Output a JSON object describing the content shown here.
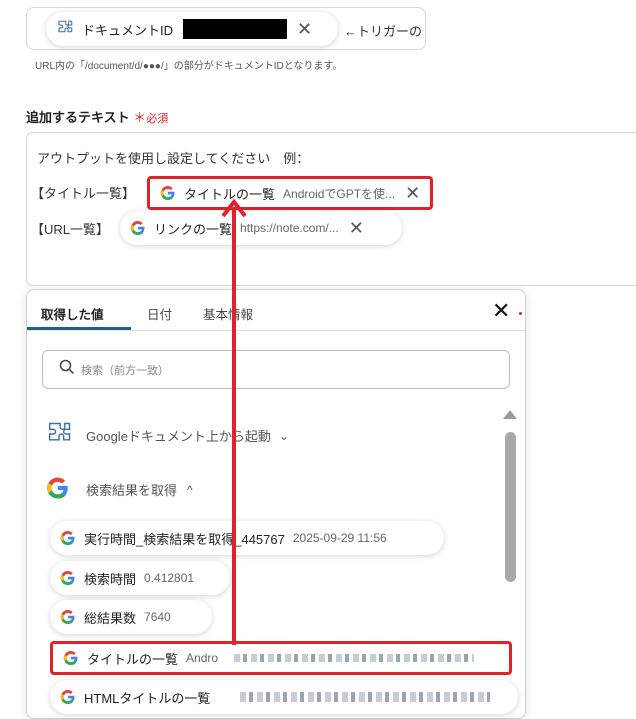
{
  "top_field": {
    "chip_label": "ドキュメントID",
    "trigger_text": "←トリガーの"
  },
  "hint": "URL内の「/document/d/●●●/」の部分がドキュメントIDとなります。",
  "section": {
    "title": "追加するテキスト",
    "required": "必須"
  },
  "textarea": {
    "intro": "アウトプットを使用し設定してください　例：",
    "row1_label": "【タイトル一覧】",
    "row1_chip": {
      "label": "タイトルの一覧",
      "value": "AndroidでGPTを使..."
    },
    "row2_label": "【URL一覧】",
    "row2_chip": {
      "label": "リンクの一覧",
      "value": "https://note.com/..."
    }
  },
  "panel": {
    "tabs": [
      "取得した値",
      "日付",
      "基本情報"
    ],
    "search_placeholder": "検索（前方一致）",
    "group1": "Googleドキュメント上から起動",
    "group2": "検索結果を取得",
    "items": [
      {
        "label": "実行時間_検索結果を取得_445767",
        "value": "2025-09-29 11:56"
      },
      {
        "label": "検索時間",
        "value": "0.412801"
      },
      {
        "label": "総結果数",
        "value": "7640"
      },
      {
        "label": "タイトルの一覧",
        "value": "Andro"
      },
      {
        "label": "HTMLタイトルの一覧",
        "value": ""
      }
    ]
  },
  "colors": {
    "accent": "#1f5f8b",
    "highlight": "#e0222a",
    "required": "#e0222a"
  }
}
